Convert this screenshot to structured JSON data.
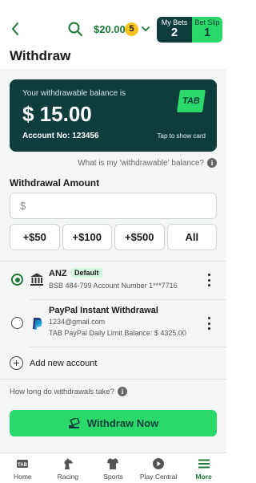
{
  "header": {
    "balance": "$20.00",
    "balance_count": "5",
    "my_bets_label": "My Bets",
    "my_bets_count": "2",
    "bet_slip_label": "Bet Slip",
    "bet_slip_count": "1"
  },
  "page": {
    "title": "Withdraw"
  },
  "card": {
    "caption": "Your withdrawable balance is",
    "amount": "$ 15.00",
    "account": "Account No: 123456",
    "tap_hint": "Tap to show card",
    "logo": "TAB"
  },
  "help": {
    "withdrawable_link": "What is my 'withdrawable' balance?"
  },
  "form": {
    "amount_label": "Withdrawal Amount",
    "amount_placeholder": "$",
    "quick_amounts": [
      "+$50",
      "+$100",
      "+$500",
      "All"
    ]
  },
  "accounts": [
    {
      "name": "ANZ",
      "badge": "Default",
      "detail": "BSB 484-799 Account Number 1***7716",
      "selected": true,
      "icon": "bank-icon"
    },
    {
      "name": "PayPal Instant Withdrawal",
      "detail": "1234@gmail.com",
      "detail2": "TAB PayPal Daily Limit Balance: $ 4325.00",
      "selected": false,
      "icon": "paypal-icon"
    }
  ],
  "add_account": "Add new account",
  "how_long": "How long do withdrawals take?",
  "withdraw_button": "Withdraw Now",
  "nav": {
    "items": [
      {
        "label": "Home",
        "icon": "tab-home-icon"
      },
      {
        "label": "Racing",
        "icon": "horse-icon"
      },
      {
        "label": "Sports",
        "icon": "jersey-icon"
      },
      {
        "label": "Play Central",
        "icon": "play-icon"
      },
      {
        "label": "More",
        "icon": "menu-icon"
      }
    ],
    "active": "More"
  },
  "colors": {
    "brand_dark": "#0f3d3e",
    "brand_green": "#2bd86a",
    "text_green": "#1b7a35",
    "badge_yellow": "#f7c320"
  }
}
